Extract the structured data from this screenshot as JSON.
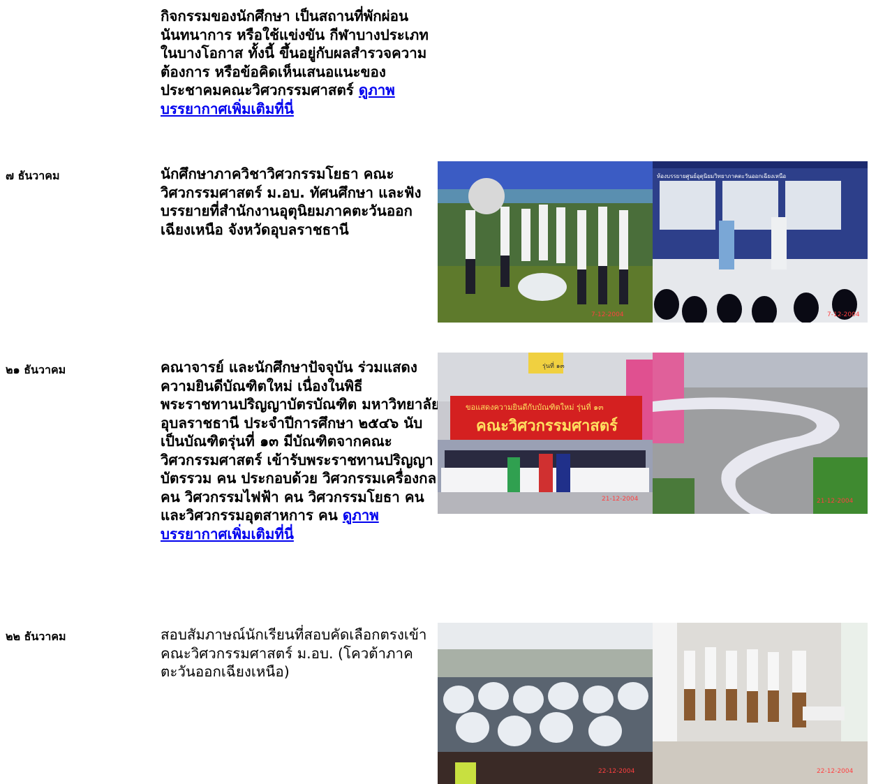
{
  "entries": [
    {
      "date": "",
      "text": "กิจกรรมของนักศึกษา เป็นสถานที่พักผ่อน นันทนาการ หรือใช้แข่งขัน กีฬาบางประเภทในบางโอกาส ทั้งนี้ ขึ้นอยู่กับผลสำรวจความต้องการ หรือข้อคิดเห็นเสนอแนะของประชาคมคณะวิศวกรรมศาสตร์ ",
      "link": "ดูภาพบรรยากาศเพิ่มเติมที่นี่"
    },
    {
      "date": "๗ ธันวาคม",
      "text": "นักศึกษาภาควิชาวิศวกรรมโยธา คณะวิศวกรรมศาสตร์ ม.อบ. ทัศนศึกษา และฟังบรรยายที่สำนักงานอุตุนิยมภาคตะวันออกเฉียงเหนือ จังหวัดอุบลราชธานี",
      "photos": [
        {
          "name": "group-photo-weather-station",
          "stamp": "7-12-2004"
        },
        {
          "name": "lecture-photo-weather-office",
          "stamp": "7-12-2004",
          "banner": "ห้องบรรยายศูนย์อุตุนิยมวิทยาภาคตะวันออกเฉียงเหนือ"
        }
      ]
    },
    {
      "date": "๒๑ ธันวาคม",
      "text": "คณาจารย์ และนักศึกษาปัจจุบัน ร่วมแสดงความยินดีบัณฑิตใหม่  เนื่องในพิธีพระราชทานปริญญาบัตรบัณฑิต มหาวิทยาลัยอุบลราชธานี ประจำปีการศึกษา ๒๕๔๖ นับเป็นบัณฑิตรุ่นที่ ๑๓ มีบัณฑิตจากคณะวิศวกรรมศาสตร์ เข้ารับพระราชทานปริญญาบัตรรวม คน ประกอบด้วย วิศวกรรมเครื่องกล คน วิศวกรรมไฟฟ้า คน วิศวกรรมโยธา คน และวิศวกรรมอุตสาหการ คน ",
      "link": "ดูภาพบรรยากาศเพิ่มเติมที่นี่",
      "photos": [
        {
          "name": "graduation-group-photo",
          "stamp": "21-12-2004",
          "banner": "คณะวิศวกรรมศาสตร์",
          "banner_top": "ขอแสดงความยินดีกับบัณฑิตใหม่ รุ่นที่ ๑๓",
          "sign": "รุ่นที่ ๑๓"
        },
        {
          "name": "graduation-line-photo",
          "stamp": "21-12-2004"
        }
      ]
    },
    {
      "date": "๒๒ ธันวาคม",
      "text": "สอบสัมภาษณ์นักเรียนที่สอบคัดเลือกตรงเข้าคณะวิศวกรรมศาสตร์ ม.อบ. (โควต้าภาคตะวันออกเฉียงเหนือ)",
      "photos": [
        {
          "name": "interview-waiting-photo",
          "stamp": "22-12-2004"
        },
        {
          "name": "interview-corridor-photo",
          "stamp": "22-12-2004"
        }
      ]
    }
  ]
}
